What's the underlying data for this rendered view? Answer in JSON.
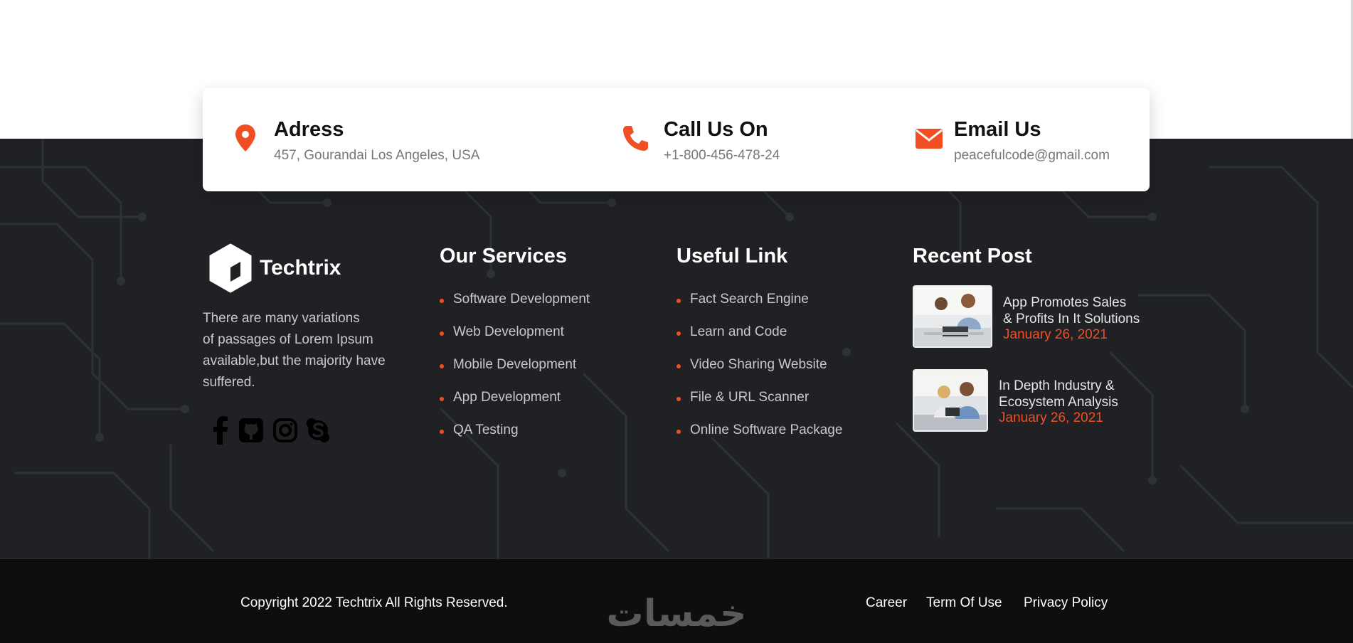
{
  "contact": {
    "address": {
      "title": "Adress",
      "value": "457, Gourandai Los Angeles, USA",
      "icon": "map-pin-icon"
    },
    "phone": {
      "title": "Call Us On",
      "value": "+1-800-456-478-24",
      "icon": "phone-icon"
    },
    "email": {
      "title": "Email Us",
      "value": "peacefulcode@gmail.com",
      "icon": "envelope-icon"
    }
  },
  "brand": {
    "name": "Techtrix",
    "logo_icon": "cube-logo-icon",
    "about": "There are many variations of passages of Lorem Ipsum available,but the majority have suffered.",
    "about_lines": [
      "There are many variations",
      "of passages of Lorem Ipsum",
      "available,but the majority have",
      "suffered."
    ],
    "socials": [
      "facebook-icon",
      "github-icon",
      "instagram-icon",
      "skype-icon"
    ]
  },
  "services": {
    "title": "Our Services",
    "items": [
      "Software Development",
      "Web Development",
      "Mobile Development",
      "App Development",
      "QA Testing"
    ]
  },
  "useful": {
    "title": "Useful Link",
    "items": [
      "Fact Search Engine",
      "Learn and Code",
      "Video Sharing Website",
      "File & URL Scanner",
      "Online Software Package"
    ]
  },
  "recent": {
    "title": "Recent Post",
    "posts": [
      {
        "title_line1": "App Promotes Sales",
        "title_line2": "& Profits In It Solutions",
        "date": "January 26, 2021"
      },
      {
        "title_line1": "In Depth Industry &",
        "title_line2": "Ecosystem Analysis",
        "date": "January 26, 2021"
      }
    ]
  },
  "bottom": {
    "copyright": "Copyright 2022 Techtrix All Rights Reserved.",
    "links": [
      "Career",
      "Term Of Use",
      "Privacy Policy"
    ],
    "watermark_text": "خمسات"
  },
  "colors": {
    "accent": "#f04e23",
    "footer_bg": "#1f2124",
    "bottom_bg": "#0e0e0e"
  }
}
